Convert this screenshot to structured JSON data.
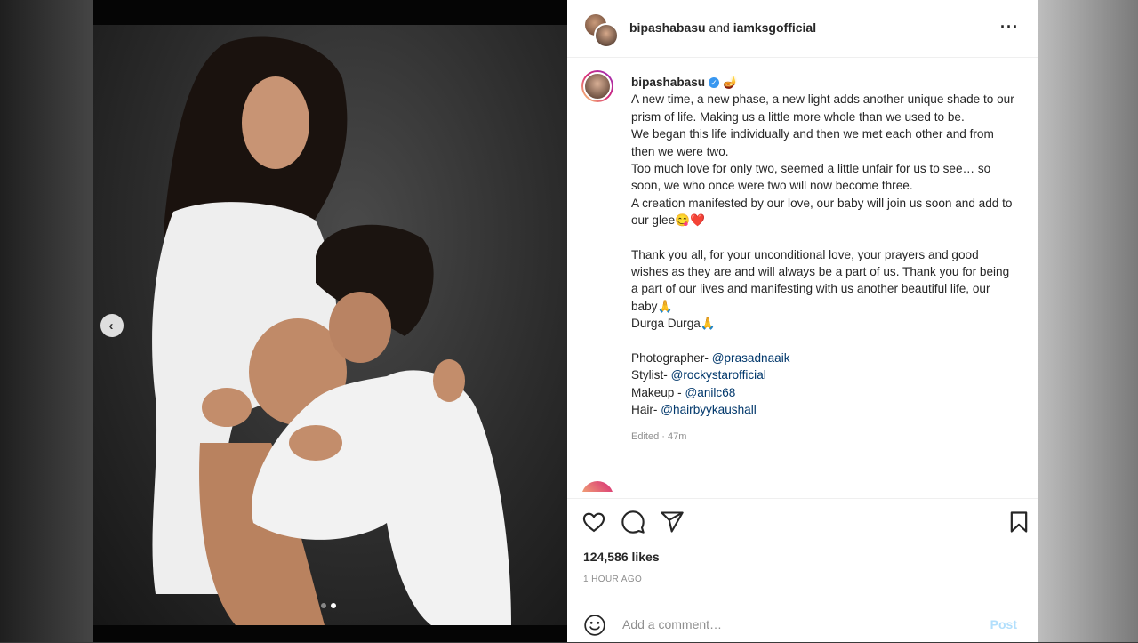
{
  "header": {
    "user1": "bipashabasu",
    "joiner": "and",
    "user2": "iamksgofficial",
    "more": "···"
  },
  "caption": {
    "username": "bipashabasu",
    "verified_glyph": "✓",
    "title_emoji": "🪔",
    "lines": [
      "A new time, a new phase, a new light adds another unique shade to our prism of life. Making us a little more whole than we used to be.",
      "We began this life individually and then we met each other and from then we were two.",
      "Too much love for only two, seemed a little unfair for us to see… so soon, we who once were two will now become three.",
      "A creation manifested by our love, our baby will join us soon and add to our glee😋❤️"
    ],
    "lines2": [
      "Thank you all, for your unconditional love, your prayers and good wishes as they are and will always be a part of us. Thank you for being a part of our lives and manifesting with us another beautiful life, our baby🙏",
      "Durga Durga🙏"
    ],
    "credits": [
      {
        "label": "Photographer- ",
        "handle": "@prasadnaaik"
      },
      {
        "label": "Stylist- ",
        "handle": "@rockystarofficial"
      },
      {
        "label": "Makeup - ",
        "handle": "@anilc68"
      },
      {
        "label": "Hair- ",
        "handle": "@hairbyykaushall"
      }
    ],
    "edited": "Edited · 47m"
  },
  "next_comment_preview": "",
  "actions": {
    "like_icon": "heart-icon",
    "comment_icon": "comment-icon",
    "share_icon": "share-icon",
    "save_icon": "bookmark-icon"
  },
  "likes": "124,586 likes",
  "timestamp": "1 HOUR AGO",
  "comment_box": {
    "placeholder": "Add a comment…",
    "post_label": "Post"
  },
  "carousel": {
    "prev_glyph": "‹",
    "slides": 2,
    "active_slide": 2
  },
  "colors": {
    "link": "#00376b",
    "post_disabled": "#b2dffc",
    "verified": "#3897f0"
  }
}
